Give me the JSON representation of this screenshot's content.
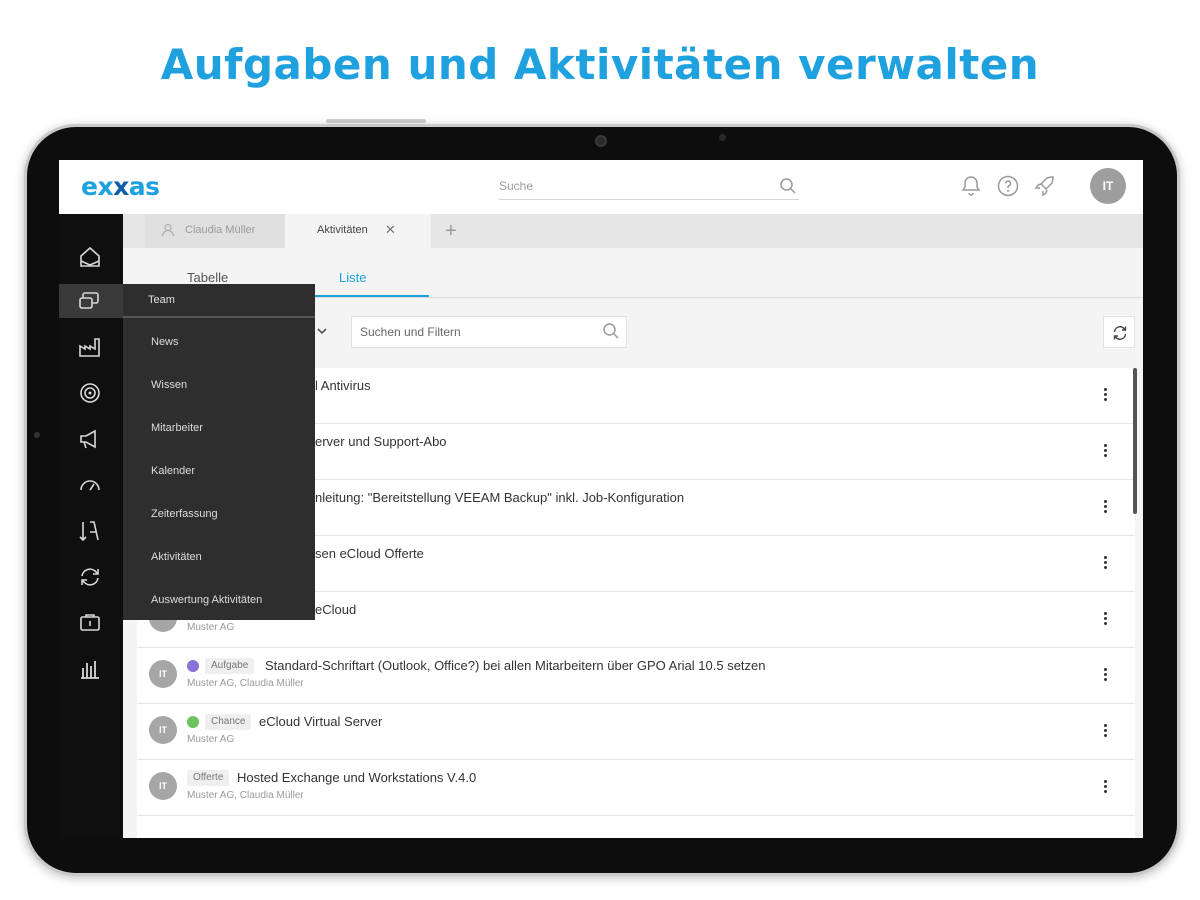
{
  "headline": "Aufgaben und Aktivitäten verwalten",
  "header": {
    "logo_a": "ex",
    "logo_b": "x",
    "logo_c": "as",
    "search_placeholder": "Suche",
    "avatar": "IT"
  },
  "colors": {
    "brand": "#1ea1de",
    "brand_dark": "#0b5fa8"
  },
  "file_tabs": [
    {
      "label": "Claudia Müller"
    },
    {
      "label": "Aktivitäten",
      "close": "✕"
    },
    {
      "label": "+"
    }
  ],
  "sub_tabs": {
    "tabelle": "Tabelle",
    "liste": "Liste"
  },
  "filter": {
    "placeholder": "Suchen und Filtern"
  },
  "menu": {
    "header": "Team",
    "items": [
      "News",
      "Wissen",
      "Mitarbeiter",
      "Kalender",
      "Zeiterfassung",
      "Aktivitäten",
      "Auswertung Aktivitäten"
    ]
  },
  "rows": [
    {
      "avatar": "",
      "title": "l Antivirus",
      "sub": ""
    },
    {
      "avatar": "",
      "title": "erver und Support-Abo",
      "sub": ""
    },
    {
      "avatar": "",
      "title": "nleitung: \"Bereitstellung VEEAM Backup\" inkl. Job-Konfiguration",
      "sub": ""
    },
    {
      "avatar": "",
      "title": "sen eCloud Offerte",
      "sub": ""
    },
    {
      "avatar": "",
      "title": "eCloud",
      "sub": "Muster AG"
    },
    {
      "avatar": "IT",
      "dot": "#8a73d6",
      "badge": "Aufgabe",
      "title": "Standard-Schriftart (Outlook, Office?) bei allen Mitarbeitern über GPO Arial 10.5 setzen",
      "sub": "Muster AG, Claudia Müller"
    },
    {
      "avatar": "IT",
      "dot": "#6cc25e",
      "badge": "Chance",
      "title": "eCloud Virtual Server",
      "sub": "Muster AG"
    },
    {
      "avatar": "IT",
      "badge": "Offerte",
      "title": "Hosted Exchange und Workstations V.4.0",
      "sub": "Muster AG, Claudia Müller"
    }
  ]
}
